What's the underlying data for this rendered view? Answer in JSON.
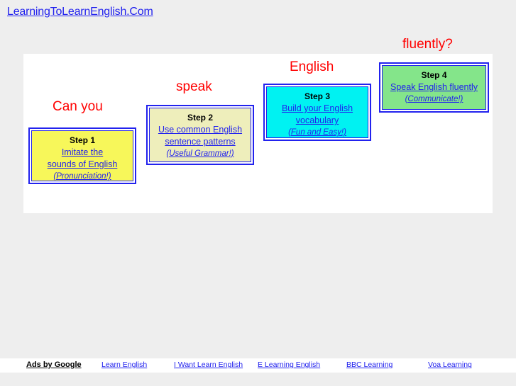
{
  "page": {
    "background_color": "#eeeeee",
    "panel_color": "#ffffff"
  },
  "header": {
    "site_title": "LearningToLearnEnglish.Com",
    "link_color": "#2222ee"
  },
  "headline": {
    "color": "#ff0000",
    "words": [
      {
        "text": "Can you"
      },
      {
        "text": "speak"
      },
      {
        "text": "English"
      },
      {
        "text": "fluently?"
      }
    ],
    "full_sentence": "Can you speak English fluently?"
  },
  "steps": [
    {
      "label": "Step 1",
      "link": "Imitate the sounds of English",
      "link_line_1": "Imitate the",
      "link_line_2": "sounds of English ",
      "note": "(Pronunciation!)",
      "fill_color": "#f7f75a",
      "border_color": "#2222ee"
    },
    {
      "label": "Step 2",
      "link": "Use common English sentence patterns",
      "link_line_1": "Use common English",
      "link_line_2": "sentence patterns ",
      "note": "(Useful Grammar!) ",
      "fill_color": "#eeeebb",
      "border_color": "#2222ee"
    },
    {
      "label": "Step 3",
      "link": "Build your English vocabulary",
      "link_line_1": "Build your English",
      "link_line_2": "vocabulary ",
      "note": "(Fun and Easy!)",
      "fill_color": "#00f2f2",
      "border_color": "#2222ee"
    },
    {
      "label": "Step 4",
      "link": "Speak English fluently",
      "link_line_1": "Speak English fluently ",
      "link_line_2": "",
      "note": "(Communicate!)",
      "fill_color": "#84e58a",
      "border_color": "#2222ee"
    }
  ],
  "ads": {
    "provider_label": "Ads by Google",
    "links": [
      "Learn English",
      "I Want Learn English",
      "E Learning English",
      "BBC Learning",
      "Voa Learning"
    ]
  }
}
